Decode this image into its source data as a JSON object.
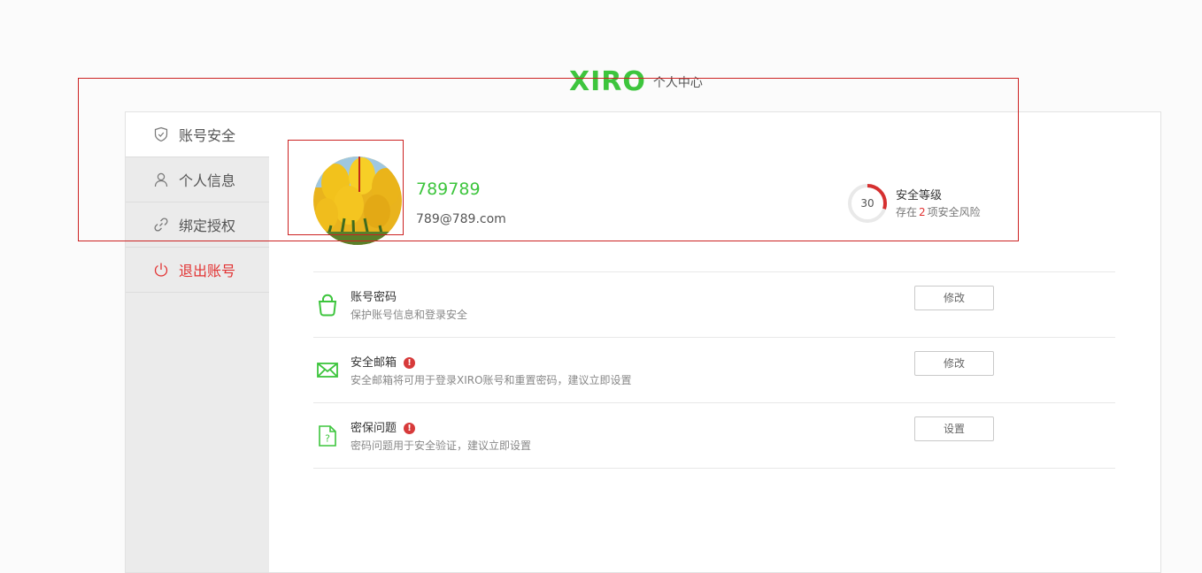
{
  "header": {
    "logo": "XIRO",
    "subtitle": "个人中心"
  },
  "sidebar": {
    "items": [
      {
        "label": "账号安全",
        "icon": "shield-icon",
        "active": true
      },
      {
        "label": "个人信息",
        "icon": "user-icon",
        "active": false
      },
      {
        "label": "绑定授权",
        "icon": "link-icon",
        "active": false
      },
      {
        "label": "退出账号",
        "icon": "power-icon",
        "active": false
      }
    ]
  },
  "profile": {
    "username": "789789",
    "email": "789@789.com",
    "avatar": "tulip-avatar"
  },
  "security": {
    "score": "30",
    "title": "安全等级",
    "desc_prefix": "存在",
    "risk_count": "2",
    "desc_suffix": "项安全风险",
    "ring_color": "#d63030"
  },
  "items": [
    {
      "title": "账号密码",
      "desc": "保护账号信息和登录安全",
      "button": "修改",
      "icon": "lock-icon",
      "warning": false
    },
    {
      "title": "安全邮箱",
      "desc": "安全邮箱将可用于登录XIRO账号和重置密码，建议立即设置",
      "button": "修改",
      "icon": "mail-icon",
      "warning": true
    },
    {
      "title": "密保问题",
      "desc": "密码问题用于安全验证，建议立即设置",
      "button": "设置",
      "icon": "question-doc-icon",
      "warning": true
    }
  ],
  "warning_glyph": "!",
  "colors": {
    "brand": "#3dc53d",
    "danger": "#e23232"
  }
}
